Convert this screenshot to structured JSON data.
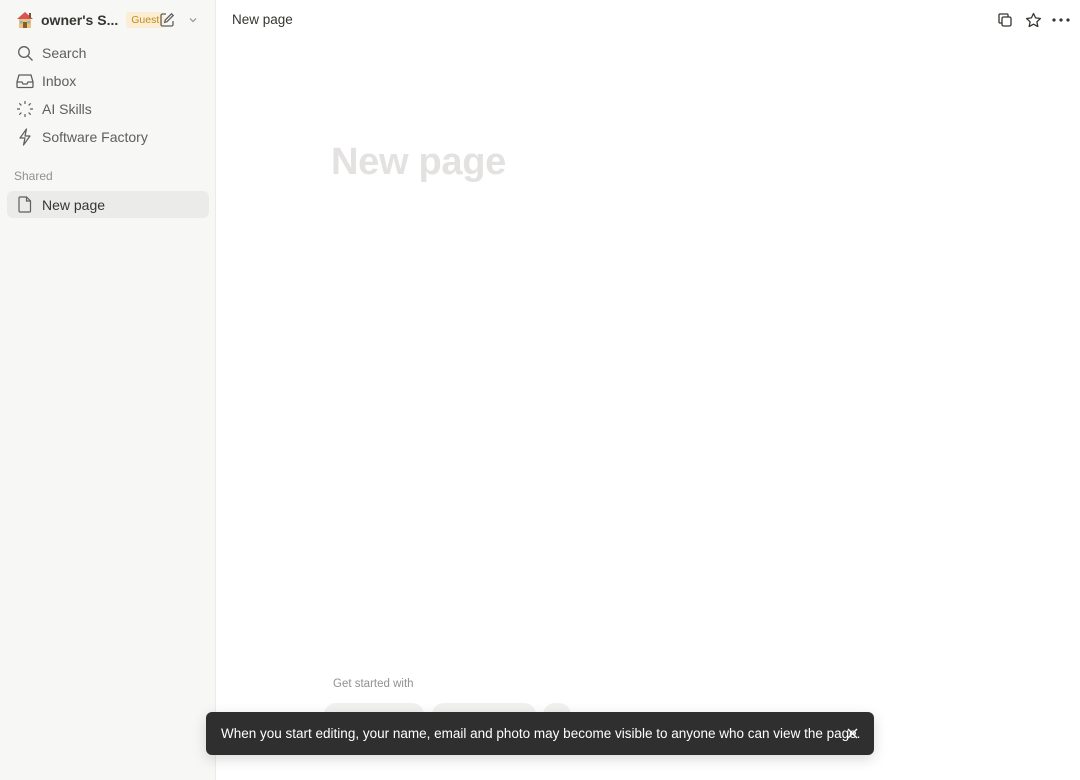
{
  "workspace": {
    "name": "owner's S...",
    "badge": "Guest"
  },
  "sidebar": {
    "items": [
      {
        "label": "Search",
        "icon": "search-icon"
      },
      {
        "label": "Inbox",
        "icon": "inbox-icon"
      },
      {
        "label": "AI Skills",
        "icon": "sparkle-icon"
      },
      {
        "label": "Software Factory",
        "icon": "lightning-icon"
      }
    ],
    "shared_section": "Shared",
    "shared_items": [
      {
        "label": "New page",
        "icon": "page-icon"
      }
    ]
  },
  "header": {
    "breadcrumb": "New page"
  },
  "page": {
    "title_placeholder": "New page",
    "get_started": "Get started with"
  },
  "toast": {
    "message": "When you start editing, your name, email and photo may become visible to anyone who can view the page."
  },
  "colors": {
    "sidebar_bg": "#f7f7f5",
    "badge_bg": "#fbeed5",
    "badge_text": "#c48a1e",
    "toast_bg": "#2f2f2f"
  }
}
